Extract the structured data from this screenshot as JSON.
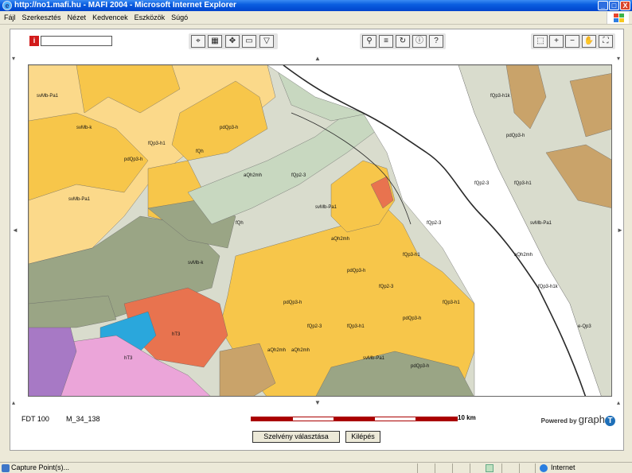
{
  "window": {
    "title": "http://no1.mafi.hu - MAFI 2004 - Microsoft Internet Explorer",
    "minimize": "_",
    "maximize": "□",
    "close": "X"
  },
  "menu": {
    "items": [
      "Fájl",
      "Szerkesztés",
      "Nézet",
      "Kedvencek",
      "Eszközök",
      "Súgó"
    ]
  },
  "toolbar": {
    "info_label": "i",
    "search_value": "",
    "tools_left": [
      "legend-icon",
      "grid-icon",
      "coordinates-icon",
      "scale-icon",
      "filter-icon"
    ],
    "tools_middle": [
      "binoculars-icon",
      "layers-icon",
      "refresh-icon",
      "info-circle-icon",
      "help-icon"
    ],
    "tools_middle_glyphs": [
      "⚲",
      "≡",
      "↻",
      "ⓘ",
      "?"
    ],
    "tools_right": [
      "zoom-box-icon",
      "zoom-in-icon",
      "zoom-out-icon",
      "pan-hand-icon",
      "full-extent-icon"
    ],
    "tools_right_glyphs": [
      "⬚",
      "+",
      "−",
      "✋",
      "⛶"
    ],
    "tools_left_glyphs": [
      "⌖",
      "▦",
      "✥",
      "▭",
      "▽"
    ]
  },
  "map": {
    "nav_arrows": {
      "up": "▲",
      "down": "▼",
      "left": "◄",
      "right": "►"
    },
    "colors": {
      "yellow": "#f7c64a",
      "pale_yellow": "#fbd98a",
      "grey_green": "#9aa585",
      "light_green": "#c8d8c0",
      "pale_grey": "#d9dccd",
      "white": "#ffffff",
      "pink": "#eba5d9",
      "cyan": "#2aa7dc",
      "orange_red": "#e8734f",
      "purple": "#a779c5",
      "tan": "#c9a36a",
      "river": "#2a2a2a"
    },
    "labels": [
      "svMb-Pa1",
      "svMb-k",
      "fQp3-h1",
      "fQh",
      "pdQp3-h",
      "aQh2mh",
      "fQp2-3",
      "svMb-Pa1",
      "fQp3-h1k",
      "pdQp3-h",
      "fQp3-h1",
      "svMb-Pa1",
      "aQh2mh",
      "pdQp3-h",
      "fQp2-3",
      "fQp3-h1",
      "pdQp3-h",
      "fQp2-3",
      "aQh2mh",
      "svMb-k",
      "fQh",
      "fQp3-h1k",
      "svMb-Pa1",
      "pdQp3-h",
      "aQh2mh",
      "fQp3-h1",
      "svMb-Pa1",
      "pdQp3-h",
      "fQp2-3",
      "hT3",
      "aQh2mh",
      "hT3",
      "pdQp3-h",
      "fQp3-h1",
      "fQp2-3",
      "e-Qp3"
    ]
  },
  "footer": {
    "sheet_scale": "FDT 100",
    "sheet_id": "M_34_138",
    "scale_label": "10",
    "scale_unit": "km",
    "powered_by": "Powered by",
    "brand": "graph",
    "brand_t": "T"
  },
  "actions": {
    "select_sheet": "Szelvény választása",
    "exit": "Kilépés"
  },
  "status": {
    "text": "Capture Point(s)...",
    "zone": "Internet"
  }
}
